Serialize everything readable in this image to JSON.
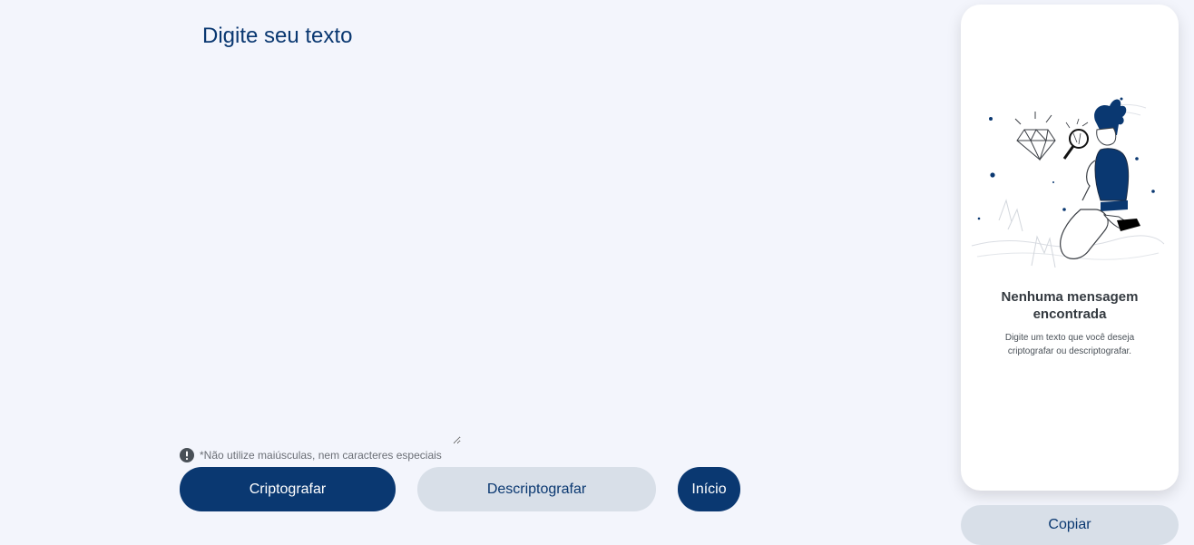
{
  "input": {
    "placeholder": "Digite seu texto",
    "value": ""
  },
  "warning": {
    "icon": "exclamation-circle-icon",
    "text": "*Não utilize maiúsculas, nem caracteres especiais"
  },
  "actions": {
    "encrypt_label": "Criptografar",
    "decrypt_label": "Descriptografar",
    "home_label": "Início"
  },
  "output_panel": {
    "illustration": "boy-with-magnifier-diamond-illustration",
    "title": "Nenhuma mensagem encontrada",
    "description": "Digite um texto que você deseja criptografar ou descriptografar.",
    "copy_label": "Copiar"
  },
  "colors": {
    "background": "#f3f5fc",
    "primary": "#0a3871",
    "secondary": "#d8dfe8",
    "panel": "#ffffff"
  }
}
